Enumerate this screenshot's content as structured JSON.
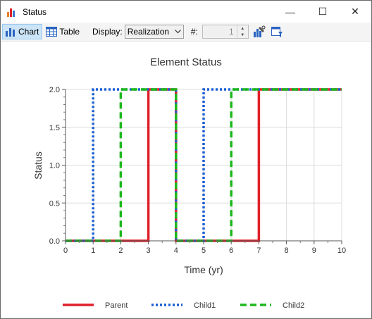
{
  "window": {
    "title": "Status",
    "minimize_glyph": "—",
    "maximize_glyph": "☐",
    "close_glyph": "✕"
  },
  "toolbar": {
    "chart_label": "Chart",
    "table_label": "Table",
    "display_label": "Display:",
    "display_value": "Realization",
    "hash_label": "#:",
    "realization_number": "1"
  },
  "icons": [
    "bar-chart-icon",
    "table-icon",
    "chevron-down-icon",
    "spin-up-icon",
    "spin-down-icon",
    "chart-properties-icon",
    "chart-style-icon"
  ],
  "colors": {
    "parent": "#e0202a",
    "child1": "#1a5fd6",
    "child2": "#1cb81c",
    "accent": "#cce4f7"
  },
  "chart_data": {
    "type": "line",
    "title": "Element Status",
    "xlabel": "Time (yr)",
    "ylabel": "Status",
    "xlim": [
      0,
      10
    ],
    "ylim": [
      0,
      2
    ],
    "x_ticks": [
      "0",
      "1",
      "2",
      "3",
      "4",
      "5",
      "6",
      "7",
      "8",
      "9",
      "10"
    ],
    "y_ticks": [
      "0.0",
      "0.5",
      "1.0",
      "1.5",
      "2.0"
    ],
    "grid": true,
    "legend_position": "bottom",
    "series": [
      {
        "name": "Parent",
        "style": "solid",
        "color": "#e0202a",
        "x": [
          0,
          3,
          3,
          4,
          4,
          7,
          7,
          10
        ],
        "y": [
          0,
          0,
          2,
          2,
          0,
          0,
          2,
          2
        ]
      },
      {
        "name": "Child1",
        "style": "dotted",
        "color": "#1a5fd6",
        "x": [
          0,
          1,
          1,
          4,
          4,
          5,
          5,
          10
        ],
        "y": [
          0,
          0,
          2,
          2,
          0,
          0,
          2,
          2
        ]
      },
      {
        "name": "Child2",
        "style": "dashed",
        "color": "#1cb81c",
        "x": [
          0,
          2,
          2,
          4,
          4,
          6,
          6,
          10
        ],
        "y": [
          0,
          0,
          2,
          2,
          0,
          0,
          2,
          2
        ]
      }
    ]
  }
}
